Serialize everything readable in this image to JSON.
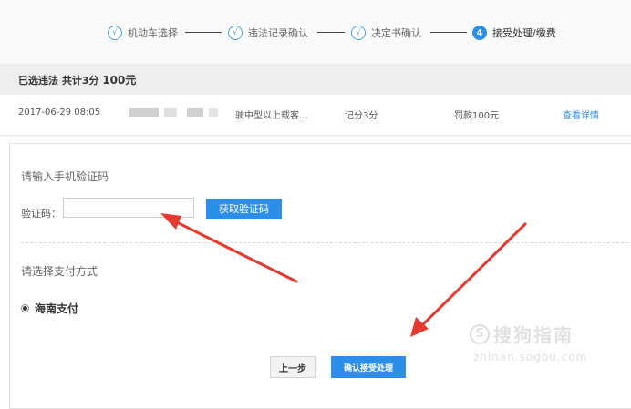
{
  "stepper": {
    "steps": [
      {
        "number": "√",
        "label": "机动车选择"
      },
      {
        "number": "√",
        "label": "违法记录确认"
      },
      {
        "number": "√",
        "label": "决定书确认"
      },
      {
        "number": "4",
        "label": "接受处理/缴费"
      }
    ]
  },
  "summary": {
    "prefix": "已选违法 共计3分 ",
    "amount": "100元"
  },
  "record": {
    "datetime": "2017-06-29 08:05",
    "description": "驶中型以上载客...",
    "points": "记分3分",
    "fine": "罚款100元",
    "detail_link": "查看详情"
  },
  "form": {
    "sms_title": "请输入手机验证码",
    "code_label": "验证码：",
    "code_value": "",
    "get_code_label": "获取验证码",
    "payment_title": "请选择支付方式",
    "payment_option": "海南支付",
    "prev_label": "上一步",
    "confirm_label": "确认接受处理"
  },
  "watermark": {
    "logo_glyph": "S",
    "text": "搜狗指南",
    "url": "zhinan.sogou.com"
  },
  "colors": {
    "accent": "#2c8ee6",
    "arrow": "#e8382f"
  }
}
